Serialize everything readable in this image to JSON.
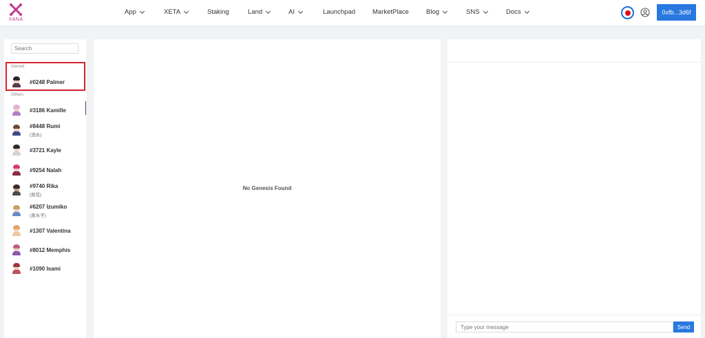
{
  "header": {
    "logo_text": "XANA",
    "nav": [
      {
        "label": "App",
        "dropdown": true
      },
      {
        "label": "XETA",
        "dropdown": true
      },
      {
        "label": "Staking",
        "dropdown": false
      },
      {
        "label": "Land",
        "dropdown": true
      },
      {
        "label": "AI",
        "dropdown": true
      },
      {
        "label": "Launchpad",
        "dropdown": false
      },
      {
        "label": "MarketPlace",
        "dropdown": false
      },
      {
        "label": "Blog",
        "dropdown": true
      },
      {
        "label": "SNS",
        "dropdown": true
      },
      {
        "label": "Docs",
        "dropdown": true
      }
    ],
    "wallet_label": "0xfb...3d6f",
    "colors": {
      "accent": "#2878e0",
      "record": "#d7131b",
      "logo": "#c0398e"
    }
  },
  "sidebar": {
    "search_placeholder": "Search",
    "owned_label": "Owned",
    "others_label": "Others",
    "owned": [
      {
        "name": "#0248 Palmer",
        "sub": ""
      }
    ],
    "others": [
      {
        "name": "#3186 Kamille",
        "sub": ""
      },
      {
        "name": "#8448 Rumi",
        "sub": "(流水)"
      },
      {
        "name": "#3721 Kayle",
        "sub": ""
      },
      {
        "name": "#9254 Nalah",
        "sub": ""
      },
      {
        "name": "#9740 Rika",
        "sub": "(梨花)"
      },
      {
        "name": "#6207 Izumiko",
        "sub": "(泉水子)"
      },
      {
        "name": "#1307 Valentina",
        "sub": ""
      },
      {
        "name": "#8012 Memphis",
        "sub": ""
      },
      {
        "name": "#1090 Isami",
        "sub": ""
      }
    ]
  },
  "main": {
    "empty_message": "No Genesis Found"
  },
  "chat": {
    "input_placeholder": "Type your message",
    "send_label": "Send"
  }
}
